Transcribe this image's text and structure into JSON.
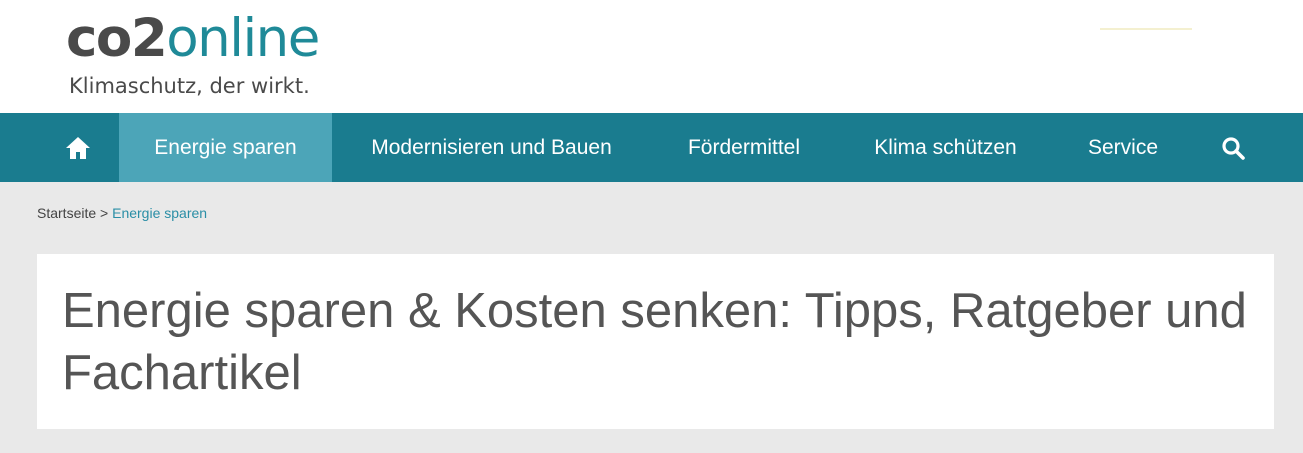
{
  "logo": {
    "name_part1": "co2",
    "name_part2": "online",
    "tagline": "Klimaschutz, der wirkt."
  },
  "nav": {
    "home_icon": "home-icon",
    "items": [
      {
        "label": "Energie sparen",
        "active": true
      },
      {
        "label": "Modernisieren und Bauen",
        "active": false
      },
      {
        "label": "Fördermittel",
        "active": false
      },
      {
        "label": "Klima schützen",
        "active": false
      },
      {
        "label": "Service",
        "active": false
      }
    ],
    "search_icon": "search-icon"
  },
  "breadcrumb": {
    "home": "Startseite",
    "separator": ">",
    "current": "Energie sparen"
  },
  "page": {
    "title": "Energie sparen & Kosten senken: Tipps, Ratgeber und Fachartikel"
  },
  "colors": {
    "brand_teal": "#1a7c8f",
    "active_tab": "#4ca5b8",
    "logo_gray": "#4a4a4a",
    "logo_teal": "#1f8a98",
    "link": "#2a8ea6",
    "background": "#e9e9e9"
  }
}
